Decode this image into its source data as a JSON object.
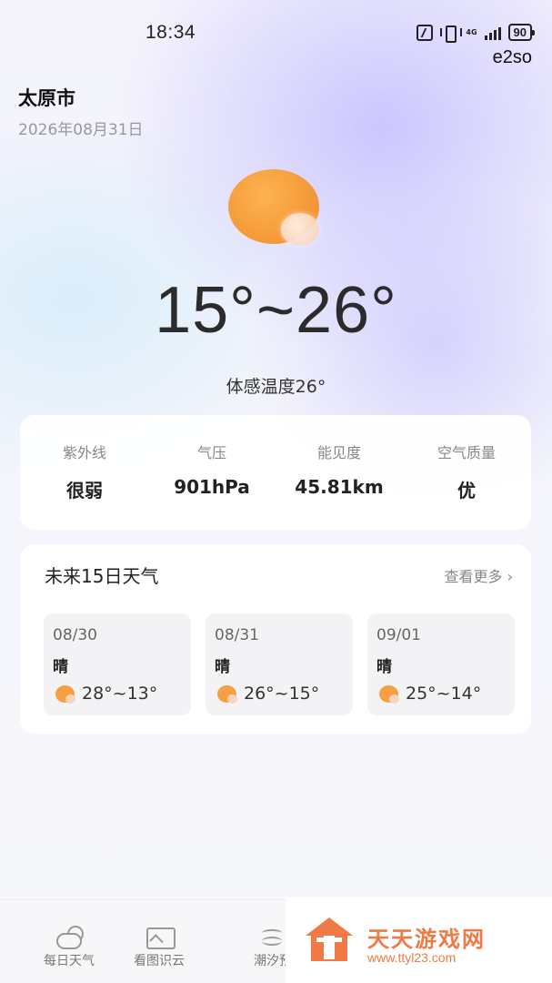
{
  "status_bar": {
    "time": "18:34",
    "network": "4G",
    "battery": "90",
    "carrier_text": "e2so"
  },
  "location": {
    "city": "太原市",
    "date": "2026年08月31日"
  },
  "current": {
    "condition_icon": "sun-with-cloud-icon",
    "temp_range": "15°~26°",
    "feels_like": "体感温度26°"
  },
  "stats": [
    {
      "label": "紫外线",
      "value": "很弱"
    },
    {
      "label": "气压",
      "value": "901hPa"
    },
    {
      "label": "能见度",
      "value": "45.81km"
    },
    {
      "label": "空气质量",
      "value": "优"
    }
  ],
  "forecast": {
    "title": "未来15日天气",
    "see_more": "查看更多",
    "days": [
      {
        "date": "08/30",
        "condition": "晴",
        "temp": "28°~13°"
      },
      {
        "date": "08/31",
        "condition": "晴",
        "temp": "26°~15°"
      },
      {
        "date": "09/01",
        "condition": "晴",
        "temp": "25°~14°"
      }
    ]
  },
  "bottom_nav": {
    "items": [
      {
        "label": "每日天气",
        "icon": "cloud-sun-icon"
      },
      {
        "label": "看图识云",
        "icon": "image-cloud-icon"
      },
      {
        "label": "潮汐预",
        "icon": "tide-icon"
      }
    ]
  },
  "watermark": {
    "title": "天天游戏网",
    "url": "www.ttyl23.com"
  },
  "colors": {
    "accent_orange": "#f6a043",
    "watermark_orange": "#f07a45"
  }
}
